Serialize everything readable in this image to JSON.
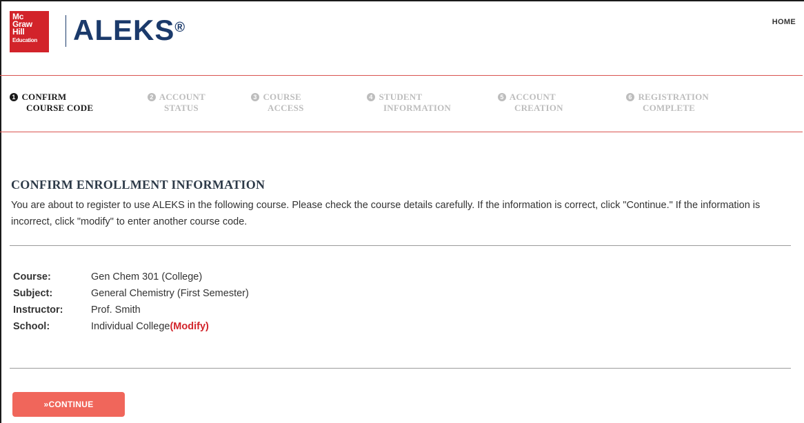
{
  "header": {
    "logo_lines": [
      "Mc",
      "Graw",
      "Hill",
      "Education"
    ],
    "brand_name": "ALEKS",
    "brand_mark": "®",
    "home_label": "HOME"
  },
  "steps": [
    {
      "number": "1",
      "line1": "CONFIRM",
      "line2": "COURSE CODE",
      "active": true
    },
    {
      "number": "2",
      "line1": "ACCOUNT",
      "line2": "STATUS",
      "active": false
    },
    {
      "number": "3",
      "line1": "COURSE",
      "line2": "ACCESS",
      "active": false
    },
    {
      "number": "4",
      "line1": "STUDENT",
      "line2": "INFORMATION",
      "active": false
    },
    {
      "number": "5",
      "line1": "ACCOUNT",
      "line2": "CREATION",
      "active": false
    },
    {
      "number": "6",
      "line1": "REGISTRATION",
      "line2": "COMPLETE",
      "active": false
    }
  ],
  "main": {
    "title": "CONFIRM ENROLLMENT INFORMATION",
    "intro": "You are about to register to use ALEKS in the following course. Please check the course details carefully. If the information is correct, click \"Continue.\" If the information is incorrect, click \"modify\" to enter another course code.",
    "details": [
      {
        "label": "Course:",
        "value": "Gen Chem 301 (College)"
      },
      {
        "label": "Subject:",
        "value": "General Chemistry (First Semester)"
      },
      {
        "label": "Instructor:",
        "value": "Prof. Smith"
      },
      {
        "label": "School:",
        "value": "Individual College"
      }
    ],
    "modify_label": "(Modify)",
    "continue_label": "»CONTINUE"
  },
  "colors": {
    "brand_red": "#d2232a",
    "brand_navy": "#1b3a6b",
    "rule_red": "#d9534f",
    "button": "#f0665b",
    "inactive_step": "#bdbdbd"
  }
}
